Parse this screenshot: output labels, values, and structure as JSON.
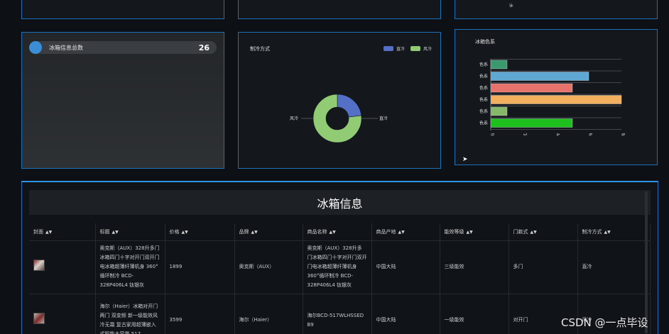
{
  "stat": {
    "label": "冰箱信息总数",
    "value": "26"
  },
  "pie": {
    "title": "制冷方式",
    "legend": [
      {
        "name": "直冷",
        "color": "#5470c6"
      },
      {
        "name": "风冷",
        "color": "#91cc75"
      }
    ],
    "labels": {
      "left": "风冷",
      "right": "直冷"
    }
  },
  "bar_panel": {
    "title": "冰箱色系"
  },
  "stub_label": "冰",
  "chart_data": [
    {
      "type": "pie",
      "title": "制冷方式",
      "categories": [
        "直冷",
        "风冷"
      ],
      "values": [
        6,
        20
      ],
      "colors": [
        "#5470c6",
        "#91cc75"
      ]
    },
    {
      "type": "bar",
      "orientation": "horizontal",
      "title": "冰箱色系",
      "categories": [
        "色系",
        "色系",
        "色系",
        "色系",
        "色系",
        "色系"
      ],
      "values": [
        1,
        6,
        5,
        8,
        1,
        5
      ],
      "colors": [
        "#3a9a6e",
        "#5fa8d3",
        "#e8736c",
        "#f2b05e",
        "#86b86a",
        "#1ec01e"
      ],
      "xlim": [
        0,
        8
      ],
      "xticks": [
        "0",
        "2",
        "4",
        "6",
        "8"
      ],
      "grid": true
    }
  ],
  "table": {
    "title": "冰箱信息",
    "columns": [
      "封面",
      "标题",
      "价格",
      "品牌",
      "商品名称",
      "商品产地",
      "能效等级",
      "门款式",
      "制冷方式"
    ],
    "rows": [
      {
        "title": "奥克斯（AUX）328升多门冰箱四门十字对开门双开门电冰箱超薄纤薄机身 360°循环制冷 BCD-328P406L4 钛银灰",
        "price": "1899",
        "brand": "奥克斯（AUX）",
        "name": "奥克斯（AUX）328升多门冰箱四门十字对开门双开门电冰箱超薄纤薄机身 360°循环制冷 BCD-328P406L4 钛银灰",
        "origin": "中国大陆",
        "energy": "三级能效",
        "door": "多门",
        "cooling": "直冷"
      },
      {
        "title": "海尔（Haier）冰箱对开门两门 双变频 新一级能效风冷无霜 复古家用超薄嵌入式智能大容量 517",
        "price": "3599",
        "brand": "海尔（Haier）",
        "name": "海尔BCD-517WLHSSED B9",
        "origin": "中国大陆",
        "energy": "一级能效",
        "door": "对开门",
        "cooling": "风冷"
      }
    ]
  },
  "watermark": "CSDN @一点毕设"
}
